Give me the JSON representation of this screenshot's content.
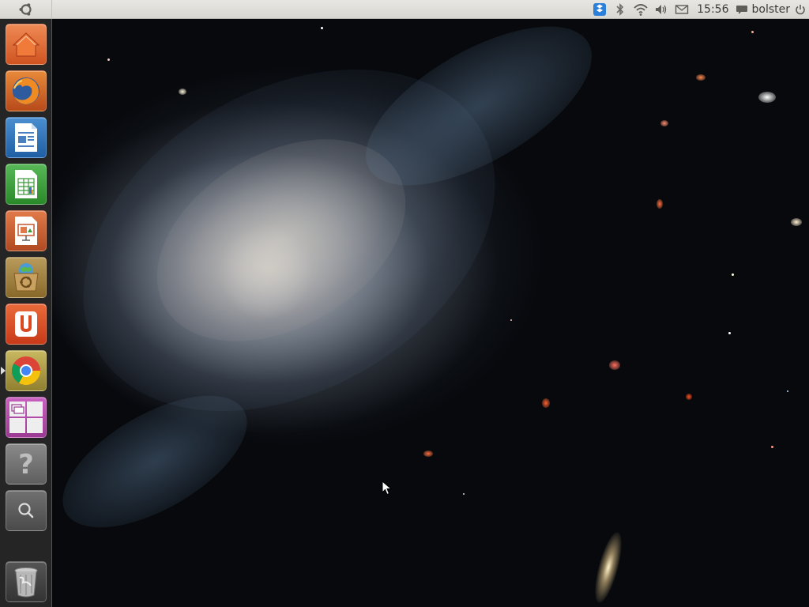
{
  "top_panel": {
    "clock": "15:56",
    "user": "bolster"
  },
  "launcher": {
    "items": [
      {
        "name": "home-folder",
        "icon": "home-icon",
        "color": "#e8662a"
      },
      {
        "name": "firefox",
        "icon": "firefox-icon",
        "color": "#d95b1e"
      },
      {
        "name": "libreoffice-writer",
        "icon": "writer-icon",
        "color": "#2a6fb5"
      },
      {
        "name": "libreoffice-calc",
        "icon": "calc-icon",
        "color": "#3a9a3a"
      },
      {
        "name": "libreoffice-impress",
        "icon": "impress-icon",
        "color": "#c4502a"
      },
      {
        "name": "ubuntu-software-center",
        "icon": "software-center-icon",
        "color": "#8a6a2a"
      },
      {
        "name": "ubuntu-one",
        "icon": "ubuntu-one-icon",
        "color": "#d9542a"
      },
      {
        "name": "google-chrome",
        "icon": "chrome-icon",
        "color": "#b5a040"
      },
      {
        "name": "workspace-switcher",
        "icon": "workspace-switcher-icon",
        "color": "#b04aa8"
      },
      {
        "name": "help",
        "icon": "help-icon",
        "color": "#7a7a7a"
      },
      {
        "name": "dash-search",
        "icon": "search-icon",
        "color": "#6a6a6a"
      },
      {
        "name": "trash",
        "icon": "trash-icon",
        "color": "#4a4a4a"
      }
    ]
  }
}
